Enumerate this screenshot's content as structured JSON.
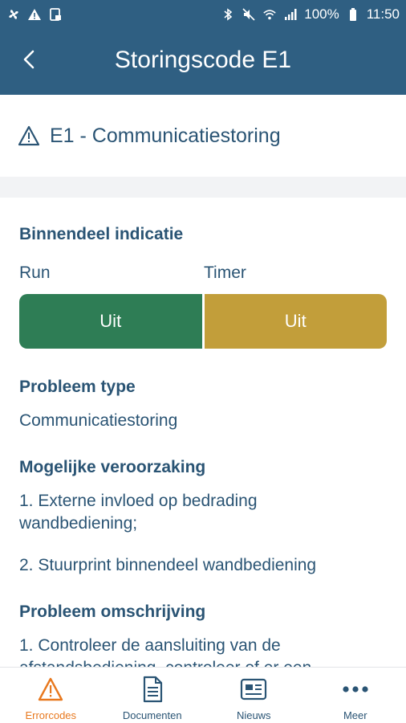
{
  "status_bar": {
    "battery": "100%",
    "time": "11:50"
  },
  "app_bar": {
    "title": "Storingscode E1",
    "back_icon": "chevron-left-icon"
  },
  "error_header": {
    "icon": "warning-icon",
    "title": "E1 - Communicatiestoring"
  },
  "indication": {
    "heading": "Binnendeel indicatie",
    "run_label": "Run",
    "timer_label": "Timer",
    "run_value": "Uit",
    "timer_value": "Uit",
    "run_color": "#2e7d55",
    "timer_color": "#c29e3a"
  },
  "problem_type": {
    "heading": "Probleem type",
    "value": "Communicatiestoring"
  },
  "causes": {
    "heading": "Mogelijke veroorzaking",
    "item1": "1. Externe invloed op bedrading wandbediening;",
    "item2": "2. Stuurprint binnendeel wandbediening"
  },
  "description": {
    "heading": "Probleem omschrijving",
    "line1": "1. Controleer de aansluiting van de",
    "line2": "afstandsbediening, controleer of er een"
  },
  "bottom_nav": {
    "active_color": "#e8781e",
    "items": [
      {
        "label": "Errorcodes",
        "icon": "warning-icon"
      },
      {
        "label": "Documenten",
        "icon": "document-icon"
      },
      {
        "label": "Nieuws",
        "icon": "news-icon"
      },
      {
        "label": "Meer",
        "icon": "more-icon"
      }
    ]
  }
}
